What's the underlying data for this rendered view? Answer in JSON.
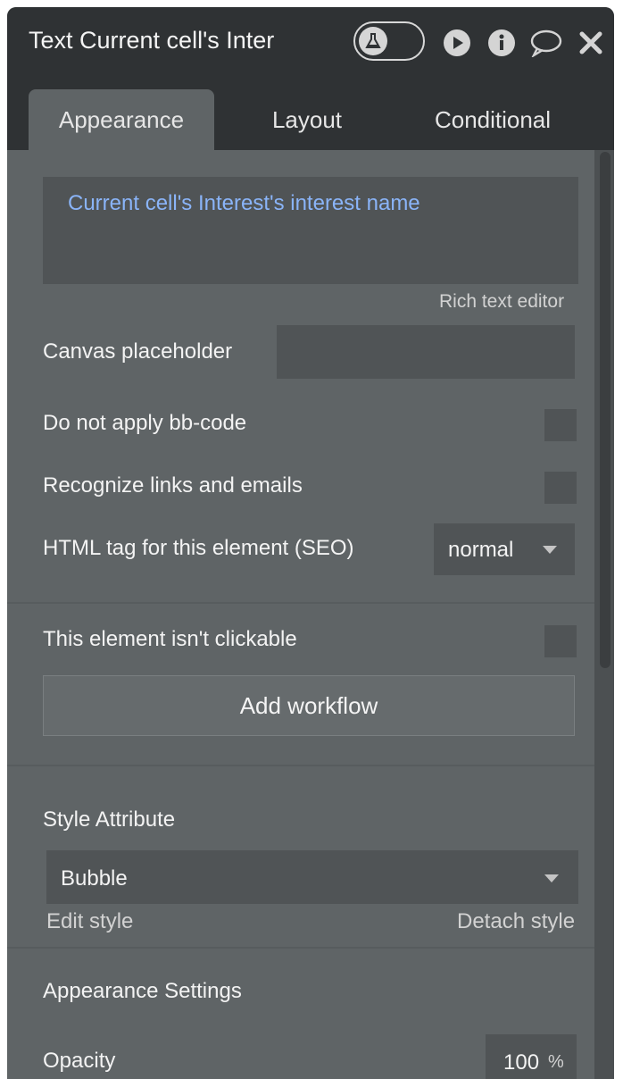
{
  "window": {
    "title": "Text Current cell's Inter"
  },
  "tabs": [
    {
      "label": "Appearance"
    },
    {
      "label": "Layout"
    },
    {
      "label": "Conditional"
    }
  ],
  "text_content": {
    "value": "Current cell's Interest's interest name",
    "rich_text_link": "Rich text editor"
  },
  "fields": {
    "canvas_placeholder": {
      "label": "Canvas placeholder",
      "value": ""
    },
    "no_bbcode": {
      "label": "Do not apply bb-code"
    },
    "recognize_links": {
      "label": "Recognize links and emails"
    },
    "html_tag": {
      "label": "HTML tag for this element (SEO)",
      "value": "normal"
    },
    "not_clickable": {
      "label": "This element isn't clickable"
    }
  },
  "buttons": {
    "add_workflow": "Add workflow"
  },
  "style": {
    "label": "Style Attribute",
    "value": "Bubble",
    "edit": "Edit style",
    "detach": "Detach style"
  },
  "appearance_settings": {
    "heading": "Appearance Settings",
    "opacity_label": "Opacity",
    "opacity_value": "100",
    "opacity_unit": "%"
  },
  "colors": {
    "panel_bg": "#5f6466",
    "header_bg": "#2f3234",
    "field_bg": "#505456",
    "link_blue": "#8ab4f8"
  }
}
